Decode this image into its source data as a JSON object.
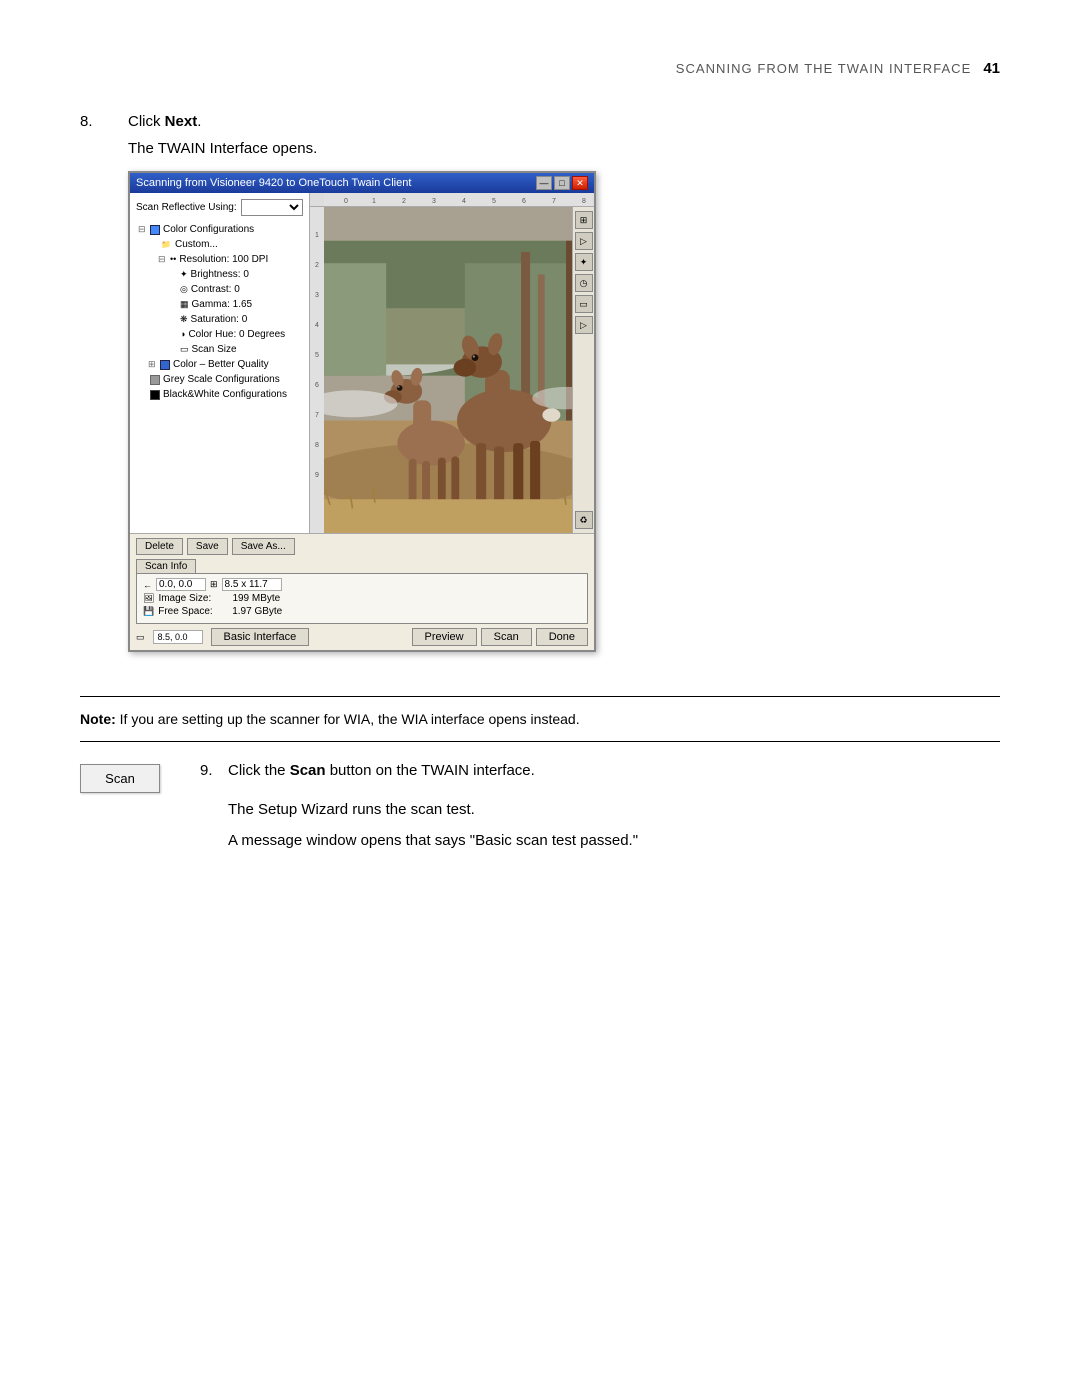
{
  "header": {
    "title": "Scanning From the TWAIN Interface",
    "page_number": "41"
  },
  "step8": {
    "number": "8.",
    "instruction": "Click ",
    "instruction_bold": "Next",
    "instruction_end": ".",
    "description": "The TWAIN Interface opens."
  },
  "twain_window": {
    "title": "Scanning from Visioneer 9420 to OneTouch Twain Client",
    "title_buttons": [
      "—",
      "□",
      "✕"
    ],
    "scan_reflective_label": "Scan Reflective Using:",
    "tree": [
      {
        "indent": 0,
        "icon": "color",
        "expand": "⊟",
        "label": "Color Configurations",
        "selected": false
      },
      {
        "indent": 1,
        "icon": "folder",
        "expand": "",
        "label": "Custom...",
        "selected": false
      },
      {
        "indent": 2,
        "icon": "dots",
        "expand": "⊟",
        "label": "Resolution: 100 DPI",
        "selected": false
      },
      {
        "indent": 3,
        "icon": "sun",
        "expand": "",
        "label": "Brightness: 0",
        "selected": false
      },
      {
        "indent": 3,
        "icon": "circle",
        "expand": "",
        "label": "Contrast: 0",
        "selected": false
      },
      {
        "indent": 3,
        "icon": "gamma",
        "expand": "",
        "label": "Gamma: 1.65",
        "selected": false
      },
      {
        "indent": 3,
        "icon": "sat",
        "expand": "",
        "label": "Saturation: 0",
        "selected": false
      },
      {
        "indent": 3,
        "icon": "hue",
        "expand": "",
        "label": "Color Hue: 0 Degrees",
        "selected": false
      },
      {
        "indent": 3,
        "icon": "size",
        "expand": "",
        "label": "Scan Size",
        "selected": false
      },
      {
        "indent": 1,
        "icon": "color2",
        "expand": "⊞",
        "label": "Color – Better Quality",
        "selected": false
      },
      {
        "indent": 0,
        "icon": "grey",
        "expand": "",
        "label": "Grey Scale Configurations",
        "selected": false
      },
      {
        "indent": 0,
        "icon": "bw",
        "expand": "",
        "label": "Black&White Configurations",
        "selected": false
      }
    ],
    "buttons": {
      "delete": "Delete",
      "save": "Save",
      "save_as": "Save As..."
    },
    "scan_info_tab": "Scan Info",
    "position": "0.0, 0.0",
    "size": "8.5 x 11.7",
    "image_size_label": "Image Size:",
    "image_size_value": "199 MByte",
    "free_space_label": "Free Space:",
    "free_space_value": "1.97 GByte",
    "pos_bottom": "8.5, 0.0",
    "bottom_buttons": {
      "basic_interface": "Basic Interface",
      "preview": "Preview",
      "scan": "Scan",
      "done": "Done"
    }
  },
  "note": {
    "label": "Note:",
    "text": " If you are setting up the scanner for WIA, the WIA interface opens instead."
  },
  "step9": {
    "number": "9.",
    "scan_button_label": "Scan",
    "instruction_start": "Click the ",
    "instruction_bold": "Scan",
    "instruction_end": " button on the TWAIN interface.",
    "description1": "The Setup Wizard runs the scan test.",
    "description2": "A message window opens that says \"Basic scan test passed.\""
  }
}
